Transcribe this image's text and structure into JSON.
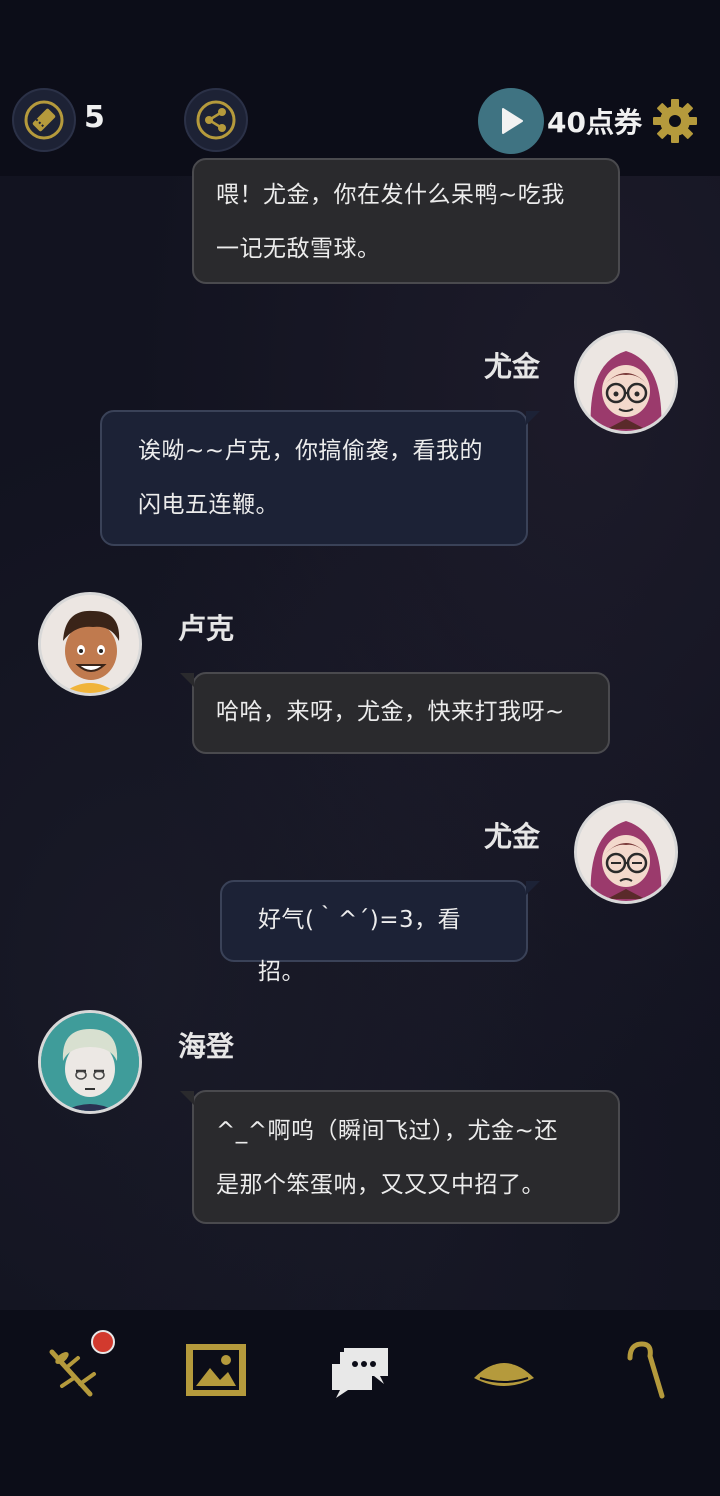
{
  "header": {
    "ticket_count": "5",
    "coupon_label": "40点券",
    "icons": {
      "ticket": "ticket-icon",
      "share": "share-icon",
      "play": "play-icon",
      "settings": "gear-icon"
    }
  },
  "messages": [
    {
      "side": "left",
      "speaker": "",
      "lines": [
        "喂！尤金，你在发什么呆鸭~吃我",
        "一记无敌雪球。"
      ]
    },
    {
      "side": "right",
      "speaker": "尤金",
      "lines": [
        "诶呦~~卢克，你搞偷袭，看我的",
        "闪电五连鞭。"
      ]
    },
    {
      "side": "left",
      "speaker": "卢克",
      "lines": [
        "哈哈，来呀，尤金，快来打我呀~"
      ]
    },
    {
      "side": "right",
      "speaker": "尤金",
      "lines": [
        "好气(｀^´)=3，看招。"
      ]
    },
    {
      "side": "left",
      "speaker": "海登",
      "lines": [
        "^_^啊呜（瞬间飞过），尤金~还",
        "是那个笨蛋呐，又又又中招了。"
      ]
    }
  ],
  "bottom_nav": {
    "items": [
      "branch-icon",
      "gallery-icon",
      "chat-icon",
      "hat-icon",
      "cane-icon"
    ],
    "colors": {
      "accent": "#b59a3c",
      "active": "#e8e8e8",
      "badge": "#d23a2e"
    }
  }
}
